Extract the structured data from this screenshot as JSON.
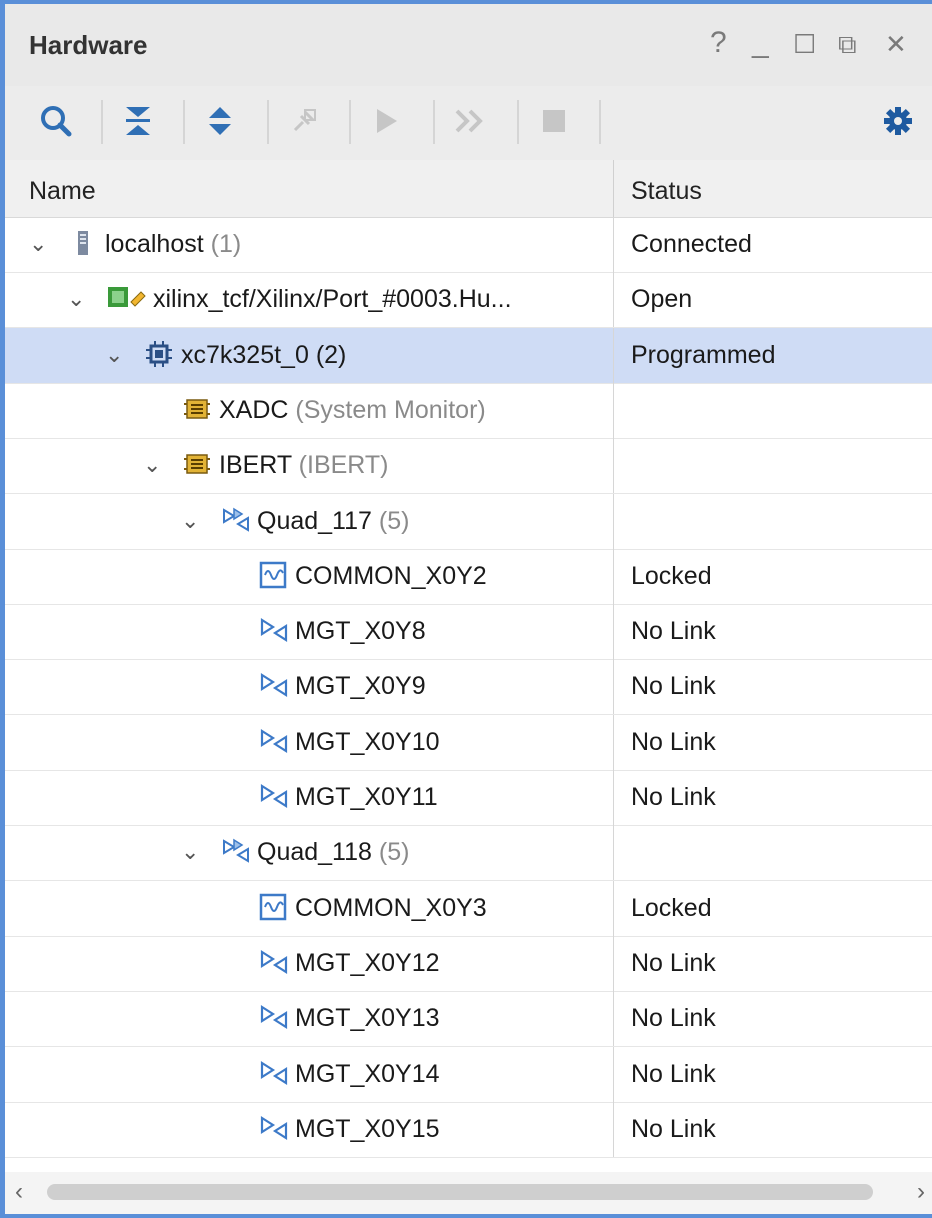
{
  "panel": {
    "title": "Hardware",
    "controls": {
      "help": "?",
      "minimize": "_",
      "maximize": "☐",
      "float": "⧉",
      "close": "✕"
    }
  },
  "toolbar": {
    "search_icon": "search-icon",
    "collapse_all_icon": "collapse-all-icon",
    "expand_all_icon": "expand-all-icon",
    "auto_connect_icon": "auto-connect-icon",
    "run_icon": "run-icon",
    "run_all_icon": "run-all-icon",
    "stop_icon": "stop-icon",
    "settings_icon": "gear-icon"
  },
  "columns": {
    "name": "Name",
    "status": "Status"
  },
  "tree": [
    {
      "label": "localhost",
      "count": "(1)",
      "status": "Connected",
      "icon": "server-icon",
      "indent": 0,
      "expanded": true,
      "selected": false
    },
    {
      "label": "xilinx_tcf/Xilinx/Port_#0003.Hu...",
      "count": "",
      "status": "Open",
      "icon": "jtag-target-icon",
      "indent": 1,
      "expanded": true,
      "selected": false
    },
    {
      "label": "xc7k325t_0",
      "count": "(2)",
      "status": "Programmed",
      "icon": "chip-icon",
      "indent": 2,
      "expanded": true,
      "selected": true
    },
    {
      "label": "XADC",
      "count": "(System Monitor)",
      "status": "",
      "icon": "debug-core-icon",
      "indent": 3,
      "expanded": null,
      "selected": false
    },
    {
      "label": "IBERT",
      "count": "(IBERT)",
      "status": "",
      "icon": "debug-core-icon",
      "indent": 3,
      "expanded": true,
      "selected": false
    },
    {
      "label": "Quad_117",
      "count": "(5)",
      "status": "",
      "icon": "quad-icon",
      "indent": 4,
      "expanded": true,
      "selected": false
    },
    {
      "label": "COMMON_X0Y2",
      "count": "",
      "status": "Locked",
      "icon": "pll-icon",
      "indent": 5,
      "expanded": null,
      "selected": false
    },
    {
      "label": "MGT_X0Y8",
      "count": "",
      "status": "No Link",
      "icon": "mgt-icon",
      "indent": 5,
      "expanded": null,
      "selected": false
    },
    {
      "label": "MGT_X0Y9",
      "count": "",
      "status": "No Link",
      "icon": "mgt-icon",
      "indent": 5,
      "expanded": null,
      "selected": false
    },
    {
      "label": "MGT_X0Y10",
      "count": "",
      "status": "No Link",
      "icon": "mgt-icon",
      "indent": 5,
      "expanded": null,
      "selected": false
    },
    {
      "label": "MGT_X0Y11",
      "count": "",
      "status": "No Link",
      "icon": "mgt-icon",
      "indent": 5,
      "expanded": null,
      "selected": false
    },
    {
      "label": "Quad_118",
      "count": "(5)",
      "status": "",
      "icon": "quad-icon",
      "indent": 4,
      "expanded": true,
      "selected": false
    },
    {
      "label": "COMMON_X0Y3",
      "count": "",
      "status": "Locked",
      "icon": "pll-icon",
      "indent": 5,
      "expanded": null,
      "selected": false
    },
    {
      "label": "MGT_X0Y12",
      "count": "",
      "status": "No Link",
      "icon": "mgt-icon",
      "indent": 5,
      "expanded": null,
      "selected": false
    },
    {
      "label": "MGT_X0Y13",
      "count": "",
      "status": "No Link",
      "icon": "mgt-icon",
      "indent": 5,
      "expanded": null,
      "selected": false
    },
    {
      "label": "MGT_X0Y14",
      "count": "",
      "status": "No Link",
      "icon": "mgt-icon",
      "indent": 5,
      "expanded": null,
      "selected": false
    },
    {
      "label": "MGT_X0Y15",
      "count": "",
      "status": "No Link",
      "icon": "mgt-icon",
      "indent": 5,
      "expanded": null,
      "selected": false
    }
  ],
  "colors": {
    "accent": "#5a8fd8",
    "selection": "#cfdcf5",
    "icon_blue": "#2f6fb5"
  }
}
